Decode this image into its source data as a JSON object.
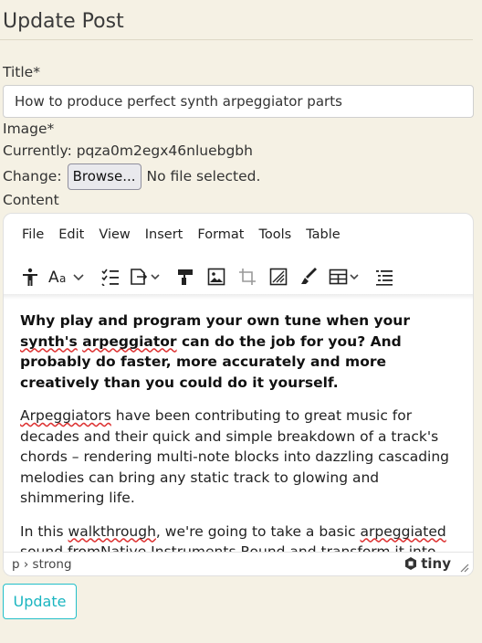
{
  "page": {
    "title": "Update Post"
  },
  "form": {
    "title_label": "Title*",
    "title_value": "How to produce perfect synth arpeggiator parts",
    "image_label": "Image*",
    "currently_text": "Currently: pqza0m2egx46nluebgbh",
    "change_label": "Change:",
    "browse_label": "Browse...",
    "no_file_text": "No file selected.",
    "content_label": "Content",
    "submit_label": "Update"
  },
  "editor": {
    "menu": [
      "File",
      "Edit",
      "View",
      "Insert",
      "Format",
      "Tools",
      "Table"
    ],
    "toolbar_icons": [
      "accessibility-icon",
      "font-size-icon",
      "checklist-icon",
      "insert-icon",
      "format-painter-icon",
      "image-icon",
      "crop-icon",
      "edit-image-icon",
      "highlighter-icon",
      "table-icon",
      "list-icon"
    ],
    "content": {
      "lead": [
        "Why play and program your own tune when your ",
        "synth's",
        " ",
        "arpeggiator",
        " can do the job for you? And probably do faster, more accurately and more creatively than you could do it yourself."
      ],
      "p1": [
        "Arpeggiators",
        " have been contributing to great music for decades and their quick and simple breakdown of a track's chords – rendering multi-note blocks into dazzling cascading melodies can bring any static track to glowing and shimmering life."
      ],
      "p2": [
        "In this ",
        "walkthrough",
        ", we're going to take a basic ",
        "arpeggiated",
        " sound ",
        "fromNative",
        " Instruments Round and transform it into something special with the help of some tasty effects."
      ]
    },
    "statusbar": {
      "path": "p › strong",
      "brand": "tiny"
    }
  },
  "colors": {
    "background": "#f5f1e4",
    "accent": "#1ab5c0"
  }
}
